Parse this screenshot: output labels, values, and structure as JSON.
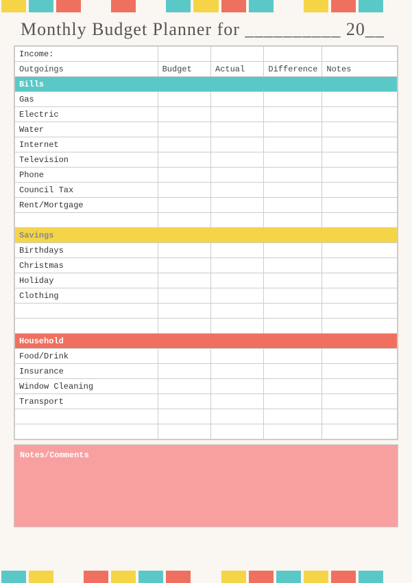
{
  "title": "Monthly Budget Planner for __________ 20__",
  "header": {
    "income_label": "Income:",
    "col_outgoings": "Outgoings",
    "col_budget": "Budget",
    "col_actual": "Actual",
    "col_difference": "Difference",
    "col_notes": "Notes"
  },
  "sections": {
    "bills": {
      "label": "Bills",
      "items": [
        "Gas",
        "Electric",
        "Water",
        "Internet",
        "Television",
        "Phone",
        "Council Tax",
        "Rent/Mortgage"
      ]
    },
    "savings": {
      "label": "Savings",
      "items": [
        "Birthdays",
        "Christmas",
        "Holiday",
        "Clothing"
      ]
    },
    "household": {
      "label": "Household",
      "items": [
        "Food/Drink",
        "Insurance",
        "Window Cleaning",
        "Transport"
      ]
    }
  },
  "notes_comments_label": "Notes/Comments",
  "border_segments": [
    "yellow",
    "teal",
    "coral",
    "white",
    "coral",
    "white",
    "teal",
    "yellow",
    "coral",
    "teal",
    "white",
    "yellow",
    "coral",
    "teal",
    "white"
  ]
}
